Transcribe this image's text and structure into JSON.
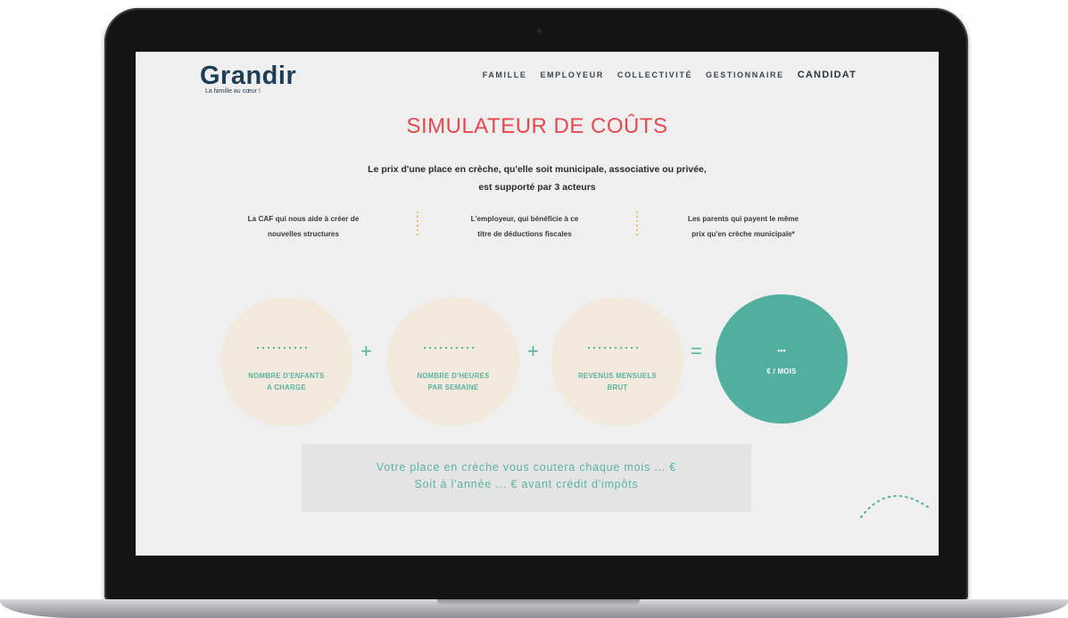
{
  "site": {
    "logo": "Grandir",
    "tagline": "La famille au cœur !"
  },
  "nav": [
    "FAMILLE",
    "EMPLOYEUR",
    "COLLECTIVITÉ",
    "GESTIONNAIRE",
    "CANDIDAT"
  ],
  "page": {
    "title": "SIMULATEUR DE COÛTS",
    "intro_line1": "Le prix d'une place en crèche, qu'elle soit municipale, associative ou privée,",
    "intro_line2": "est supporté par 3 acteurs"
  },
  "actors": [
    {
      "line1": "La CAF qui nous aide à créer de",
      "line2": "nouvelles structures"
    },
    {
      "line1": "L'employeur, qui bénéficie à ce",
      "line2": "titre de déductions fiscales"
    },
    {
      "line1": "Les parents qui payent le même",
      "line2": "prix qu'en crèche municipale*"
    }
  ],
  "calculator": {
    "inputs": [
      {
        "line1": "NOMBRE D'ENFANTS",
        "line2": "A CHARGE"
      },
      {
        "line1": "NOMBRE D'HEURES",
        "line2": "PAR SEMAINE"
      },
      {
        "line1": "REVENUS MENSUELS",
        "line2": "BRUT"
      }
    ],
    "plus": "+",
    "equals": "=",
    "result_value": "•••",
    "result_unit": "€ / MOIS"
  },
  "summary": {
    "line1": "Votre place en crèche vous coutera chaque mois ... €",
    "line2": "Soit à l'année ... € avant crédit d'impôts"
  },
  "colors": {
    "accent_red": "#e5484d",
    "teal": "#52afa0",
    "navy": "#1e3d58",
    "beige": "#f2e9dc"
  }
}
